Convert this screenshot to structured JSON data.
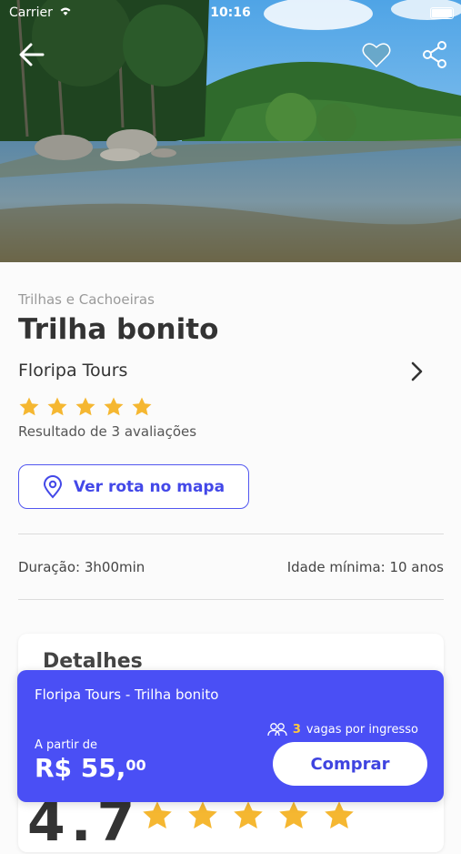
{
  "status_bar": {
    "carrier": "Carrier",
    "time": "10:16"
  },
  "icons": {
    "back": "arrow-left-icon",
    "favorite": "heart-icon",
    "share": "share-icon",
    "operator_more": "chevron-right-icon",
    "map_pin": "map-pin-icon",
    "star": "star-icon",
    "people": "people-icon"
  },
  "colors": {
    "accent": "#4a4ff5",
    "star": "#f5b731",
    "seats_number": "#ffc83d"
  },
  "tour": {
    "category": "Trilhas e Cachoeiras",
    "title": "Trilha bonito",
    "operator": "Floripa Tours",
    "rating_stars": 5,
    "reviews_text": "Resultado de 3 avaliações",
    "route_button": "Ver rota no mapa",
    "duration": "Duração: 3h00min",
    "min_age": "Idade mínima: 10 anos",
    "details_heading": "Detalhes",
    "rating_value": "4.7"
  },
  "buy_bar": {
    "title": "Floripa Tours - Trilha bonito",
    "seats_number": "3",
    "seats_label": "vagas por ingresso",
    "from_label": "A partir de",
    "price_main": "R$ 55,",
    "price_cents": "00",
    "buy_button": "Comprar"
  }
}
